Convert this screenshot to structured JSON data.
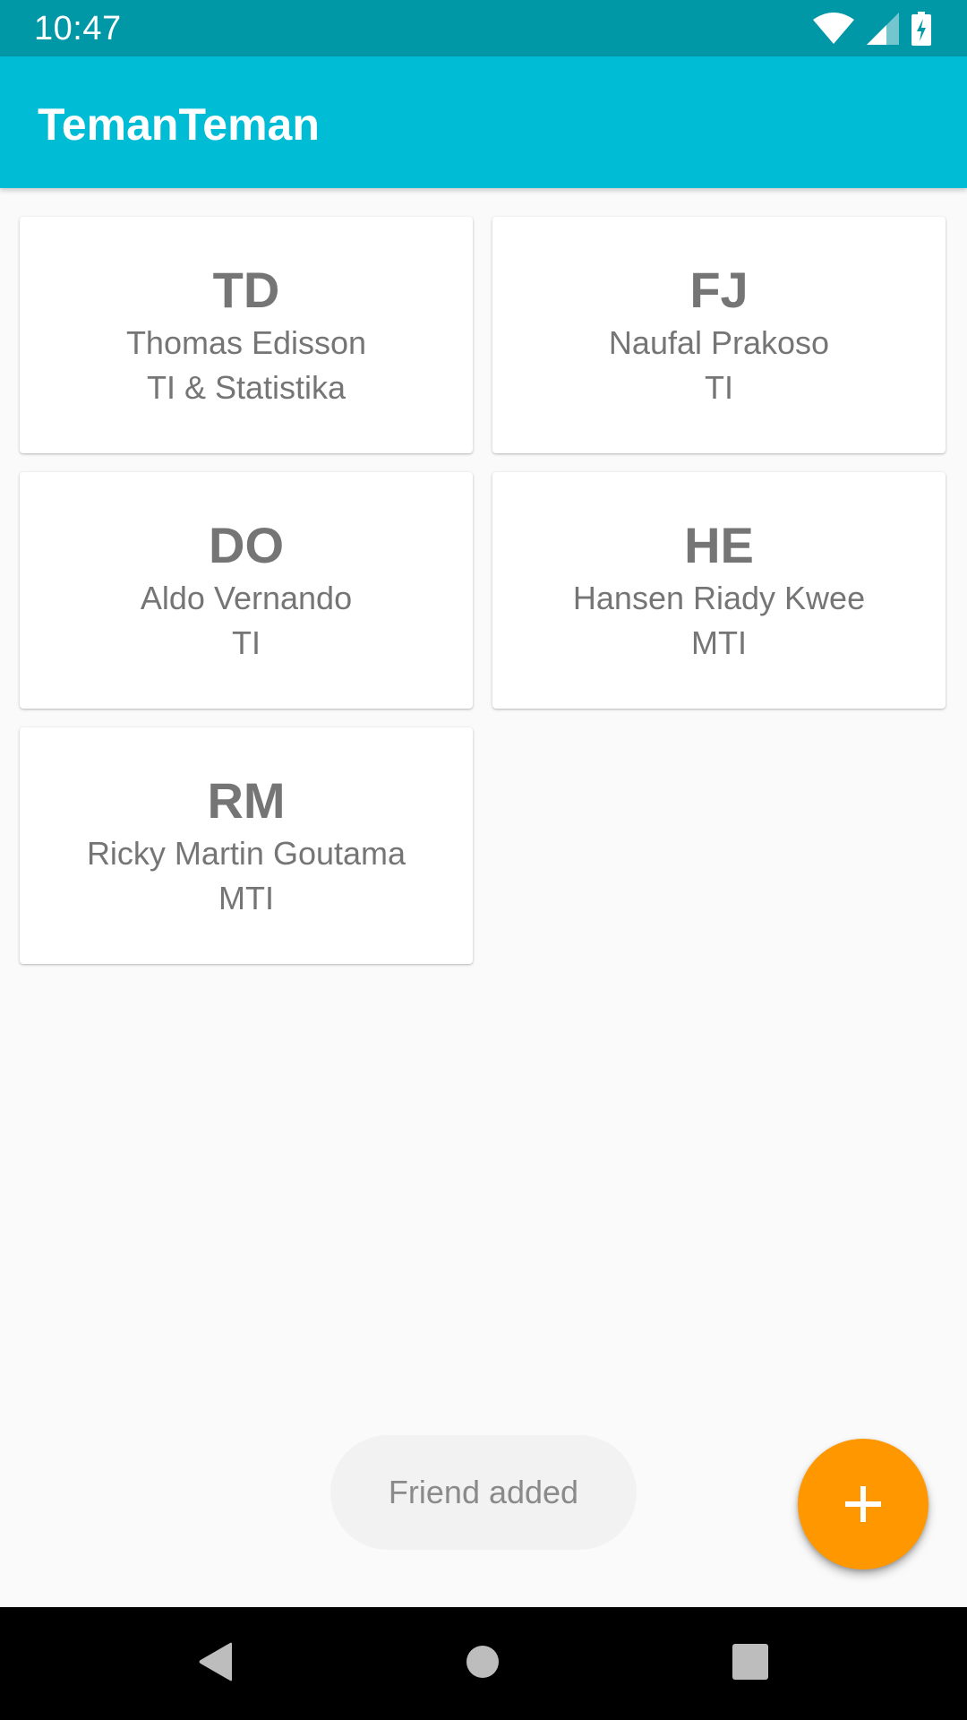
{
  "status_bar": {
    "time": "10:47",
    "icons": [
      "wifi-icon",
      "signal-icon",
      "battery-charging-icon"
    ]
  },
  "app_bar": {
    "title": "TemanTeman",
    "color": "#00bcd4",
    "status_color": "#0097a7"
  },
  "friends": [
    {
      "initials": "TD",
      "name": "Thomas Edisson",
      "major": "TI & Statistika"
    },
    {
      "initials": "FJ",
      "name": "Naufal Prakoso",
      "major": "TI"
    },
    {
      "initials": "DO",
      "name": "Aldo Vernando",
      "major": "TI"
    },
    {
      "initials": "HE",
      "name": "Hansen Riady Kwee",
      "major": "MTI"
    },
    {
      "initials": "RM",
      "name": "Ricky Martin Goutama",
      "major": "MTI"
    }
  ],
  "toast": {
    "message": "Friend added"
  },
  "fab": {
    "icon": "plus-icon",
    "color": "#ff9800"
  },
  "nav_bar": {
    "icons": [
      "back-icon",
      "home-icon",
      "recents-icon"
    ]
  }
}
